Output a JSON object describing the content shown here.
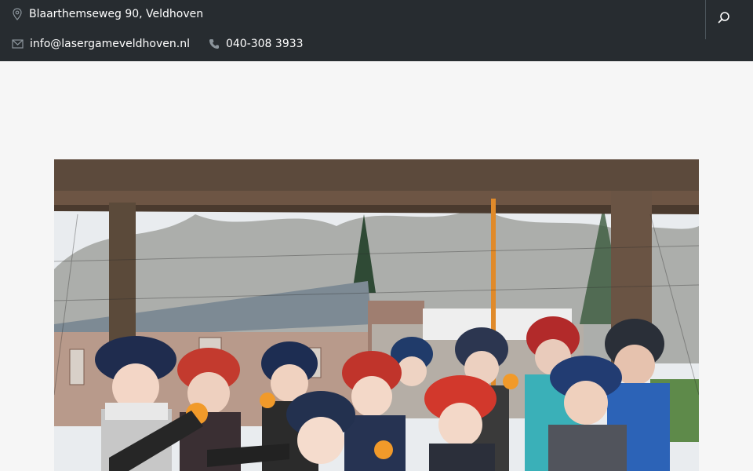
{
  "topbar": {
    "address": "Blaarthemseweg 90, Veldhoven",
    "email": "info@lasergameveldhoven.nl",
    "phone": "040-308 3933",
    "icons": [
      "map-pin-icon",
      "mail-icon",
      "phone-icon",
      "search-icon"
    ]
  },
  "colors": {
    "topbar_bg": "#272c30",
    "page_bg": "#f6f6f6",
    "icon_gray": "#8b949b",
    "text": "#ffffff"
  }
}
